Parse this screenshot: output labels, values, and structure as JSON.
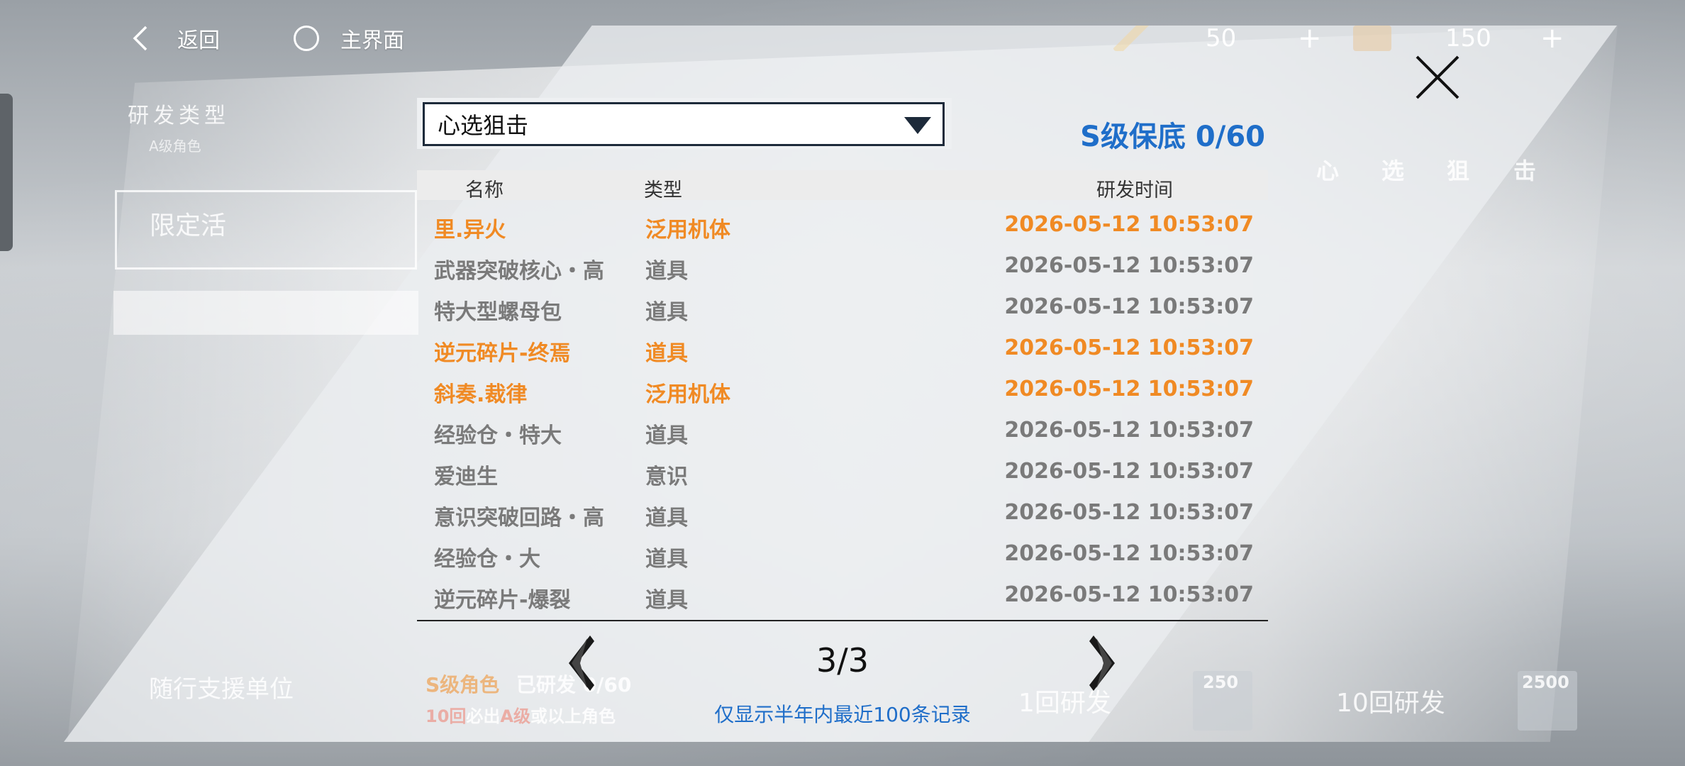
{
  "topbar": {
    "back_label": "返回",
    "home_label": "主界面",
    "resource1_value": "50",
    "resource1_plus": "+",
    "resource2_value": "150",
    "resource2_plus": "+"
  },
  "background": {
    "research_type_title": "研发类型",
    "research_type_sub": "A级角色",
    "limited_label": "限定活",
    "pool_title_chars": [
      "心",
      "选",
      "狙",
      "击"
    ],
    "companion_label": "随行支援单位",
    "s_guarantee_prefix": "S级角色",
    "s_guarantee_suffix": "已研发",
    "s_guarantee_count": "0/60",
    "ten_pull_note_a": "10回",
    "ten_pull_note_b": "必出",
    "ten_pull_note_c": "A级",
    "ten_pull_note_d": "或以上角色",
    "one_pull_label": "1回研发",
    "one_pull_cost": "250",
    "ten_pull_label": "10回研发",
    "ten_pull_cost": "2500"
  },
  "dialog": {
    "pool_select_value": "心选狙击",
    "pity_label": "S级保底 0/60",
    "columns": {
      "name": "名称",
      "type": "类型",
      "time": "研发时间"
    },
    "records": [
      {
        "name": "里.异火",
        "type": "泛用机体",
        "time": "2026-05-12 10:53:07",
        "highlight": true
      },
      {
        "name": "武器突破核心・高",
        "type": "道具",
        "time": "2026-05-12 10:53:07",
        "highlight": false
      },
      {
        "name": "特大型螺母包",
        "type": "道具",
        "time": "2026-05-12 10:53:07",
        "highlight": false
      },
      {
        "name": "逆元碎片-终焉",
        "type": "道具",
        "time": "2026-05-12 10:53:07",
        "highlight": true
      },
      {
        "name": "斜奏.裁律",
        "type": "泛用机体",
        "time": "2026-05-12 10:53:07",
        "highlight": true
      },
      {
        "name": "经验仓・特大",
        "type": "道具",
        "time": "2026-05-12 10:53:07",
        "highlight": false
      },
      {
        "name": "爱迪生",
        "type": "意识",
        "time": "2026-05-12 10:53:07",
        "highlight": false
      },
      {
        "name": "意识突破回路・高",
        "type": "道具",
        "time": "2026-05-12 10:53:07",
        "highlight": false
      },
      {
        "name": "经验仓・大",
        "type": "道具",
        "time": "2026-05-12 10:53:07",
        "highlight": false
      },
      {
        "name": "逆元碎片-爆裂",
        "type": "道具",
        "time": "2026-05-12 10:53:07",
        "highlight": false
      }
    ],
    "page_indicator": "3/3",
    "footer_note": "仅显示半年内最近100条记录"
  },
  "colors": {
    "highlight": "#f08a24",
    "normal_text": "#7a7a7a",
    "accent_blue": "#1f6ec9"
  },
  "icons": {
    "back": "chevron-left-icon",
    "home": "circle-icon",
    "close": "close-icon",
    "prev": "chevron-left-icon",
    "next": "chevron-right-icon",
    "dropdown": "triangle-down-icon"
  }
}
